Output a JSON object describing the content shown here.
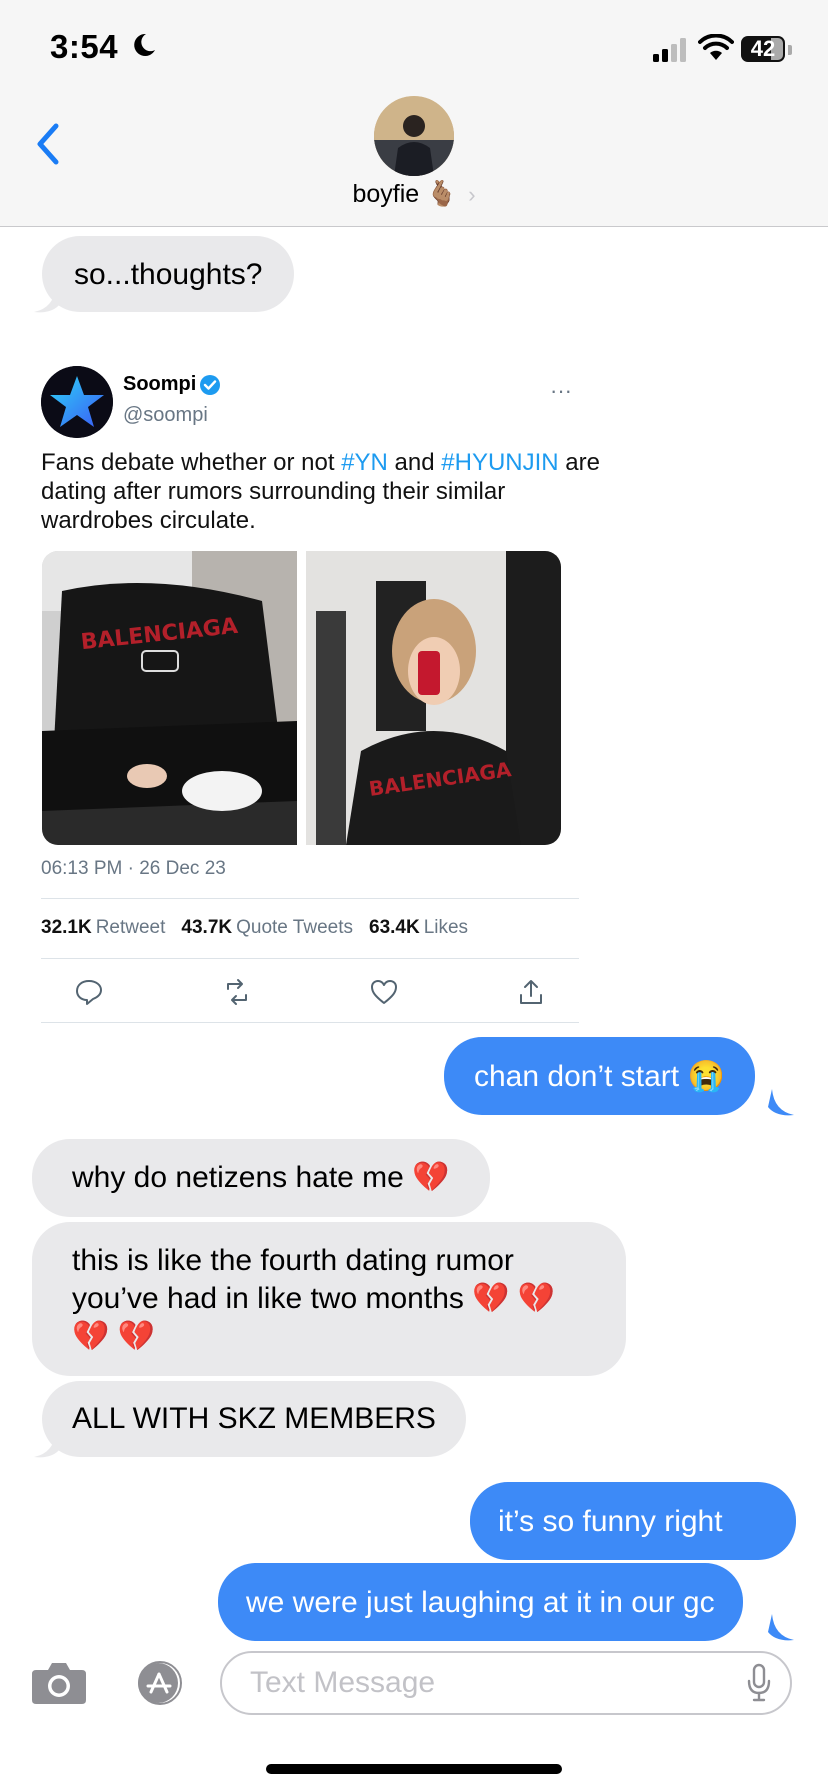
{
  "status_bar": {
    "time": "3:54",
    "battery": "42"
  },
  "contact": {
    "name": "boyfie 🫰🏽"
  },
  "messages": [
    {
      "dir": "in",
      "text": "so...thoughts?"
    },
    {
      "dir": "out",
      "text": "chan don’t start 😭"
    },
    {
      "dir": "in",
      "text": "why do netizens hate me 💔"
    },
    {
      "dir": "in",
      "text": "this is like the fourth dating rumor you’ve had in like two months 💔 💔 💔 💔"
    },
    {
      "dir": "in",
      "text": "ALL WITH SKZ MEMBERS"
    },
    {
      "dir": "out",
      "text": "it’s so funny right"
    },
    {
      "dir": "out",
      "text": "we were just laughing at it in our gc"
    }
  ],
  "tweet": {
    "name": "Soompi",
    "handle": "@soompi",
    "more": "···",
    "text_pre": "Fans debate whether or not ",
    "hashtag1": "#YN",
    "text_mid": " and ",
    "hashtag2": "#HYUNJIN",
    "text_post": " are dating after rumors surrounding their similar wardrobes circulate.",
    "date": "06:13 PM · 26 Dec 23",
    "retweets": "32.1K",
    "retweets_label": "Retweet",
    "quotes": "43.7K",
    "quotes_label": "Quote Tweets",
    "likes": "63.4K",
    "likes_label": "Likes",
    "image1_shirt_text": "BALENCIAGA",
    "image2_shirt_text": "BALENCIAGA"
  },
  "input": {
    "placeholder": "Text Message"
  },
  "colors": {
    "outgoing": "#3d8af7",
    "incoming": "#e9e9eb",
    "link": "#1d9bf0",
    "ios_blue": "#1a7cf5"
  }
}
